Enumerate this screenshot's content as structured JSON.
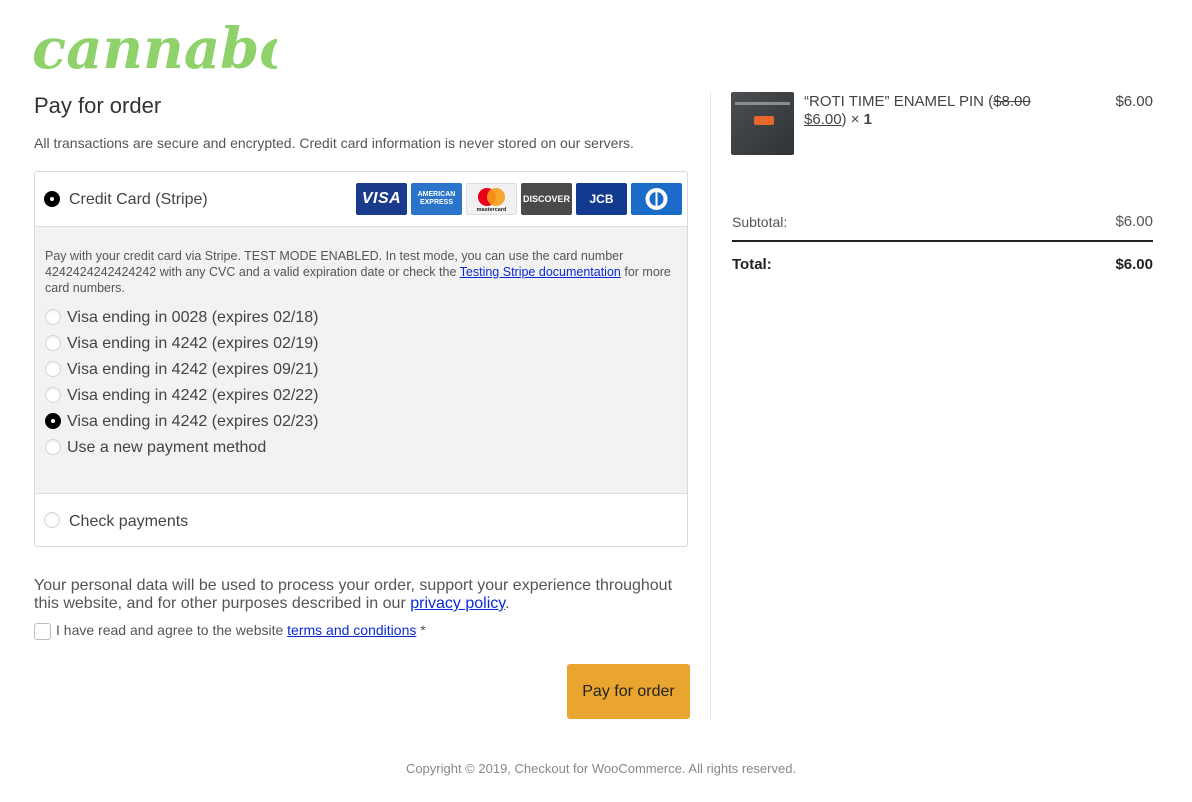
{
  "brand": {
    "logo_text": "cannabox",
    "color": "#8fd16a"
  },
  "page": {
    "title": "Pay for order",
    "secure_note": "All transactions are secure and encrypted. Credit card information is never stored on our servers."
  },
  "payment": {
    "stripe_label": "Credit Card (Stripe)",
    "card_icons": [
      "VISA",
      "AMERICAN EXPRESS",
      "mastercard",
      "DISCOVER",
      "JCB",
      "Diners"
    ],
    "stripe_desc_pre": "Pay with your credit card via Stripe. TEST MODE ENABLED. In test mode, you can use the card number 4242424242424242 with any CVC and a valid expiration date or check the ",
    "stripe_desc_link": "Testing Stripe documentation",
    "stripe_desc_post": " for more card numbers.",
    "saved_methods": [
      {
        "label": "Visa ending in 0028 (expires 02/18)",
        "selected": false
      },
      {
        "label": "Visa ending in 4242 (expires 02/19)",
        "selected": false
      },
      {
        "label": "Visa ending in 4242 (expires 09/21)",
        "selected": false
      },
      {
        "label": "Visa ending in 4242 (expires 02/22)",
        "selected": false
      },
      {
        "label": "Visa ending in 4242 (expires 02/23)",
        "selected": true
      },
      {
        "label": "Use a new payment method",
        "selected": false
      }
    ],
    "check_label": "Check payments"
  },
  "privacy": {
    "text_pre": "Your personal data will be used to process your order, support your experience throughout this website, and for other purposes described in our ",
    "link": "privacy policy",
    "text_post": "."
  },
  "terms": {
    "text_pre": "I have read and agree to the website ",
    "link": "terms and conditions",
    "required": "*"
  },
  "pay_button": "Pay for order",
  "order": {
    "item_name_pre": "“ROTI TIME” ENAMEL PIN (",
    "old_price": "$8.00",
    "new_price": "$6.00",
    "qty_sep": ") × ",
    "qty": "1",
    "item_price": "$6.00",
    "subtotal_label": "Subtotal:",
    "subtotal_value": "$6.00",
    "total_label": "Total:",
    "total_value": "$6.00"
  },
  "footer": "Copyright © 2019, Checkout for WooCommerce. All rights reserved."
}
